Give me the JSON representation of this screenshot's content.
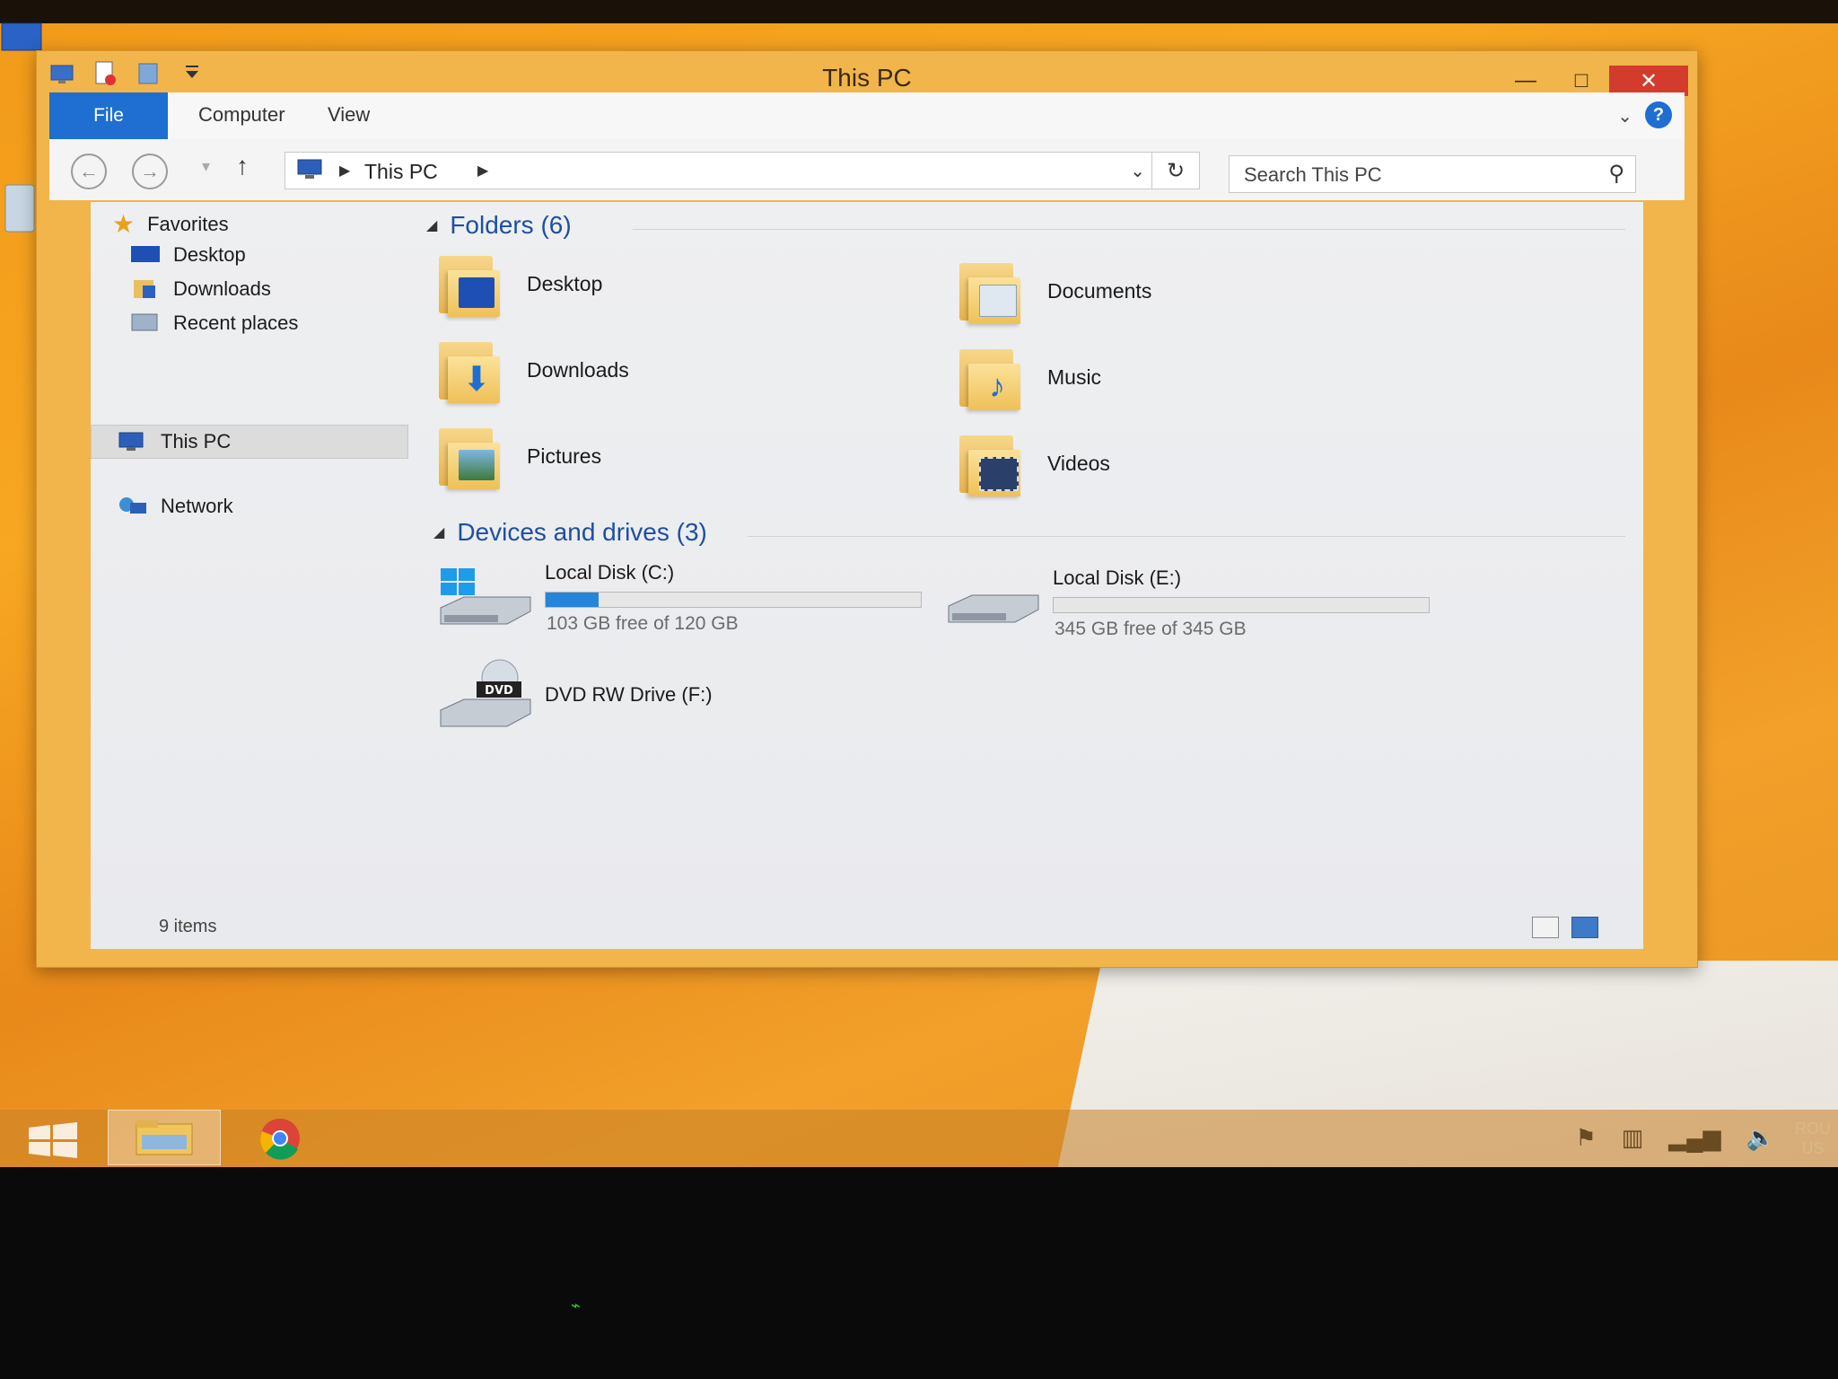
{
  "window": {
    "title": "This PC",
    "controls": {
      "minimize": "—",
      "maximize": "□",
      "close": "✕"
    }
  },
  "ribbon": {
    "tabs": [
      {
        "label": "File"
      },
      {
        "label": "Computer"
      },
      {
        "label": "View"
      }
    ],
    "help": "?"
  },
  "navigation": {
    "address_crumb": "This PC",
    "search_placeholder": "Search This PC"
  },
  "sidebar": {
    "favorites_header": "Favorites",
    "favorites": [
      "Desktop",
      "Downloads",
      "Recent places"
    ],
    "this_pc": "This PC",
    "network": "Network"
  },
  "folders_group": {
    "header": "Folders (6)",
    "items": [
      "Desktop",
      "Documents",
      "Downloads",
      "Music",
      "Pictures",
      "Videos"
    ]
  },
  "drives_group": {
    "header": "Devices and drives (3)",
    "drives": [
      {
        "name": "Local Disk (C:)",
        "free_text": "103 GB free of 120 GB",
        "used_fraction": 0.14
      },
      {
        "name": "Local Disk (E:)",
        "free_text": "345 GB free of 345 GB",
        "used_fraction": 0.0
      },
      {
        "name": "DVD RW Drive (F:)"
      }
    ]
  },
  "status": {
    "item_count": "9 items"
  },
  "taskbar": {
    "lang_top": "ROU",
    "lang_bottom": "US"
  },
  "colors": {
    "accent": "#1e6fd1",
    "group_header": "#1d4fa3",
    "desktop": "#f29a1a",
    "drive_fill": "#2684da"
  },
  "icons": [
    "computer-icon",
    "folder-icon",
    "drive-icon",
    "dvd-icon",
    "star-icon",
    "network-icon",
    "windows-logo-icon",
    "chrome-icon"
  ]
}
